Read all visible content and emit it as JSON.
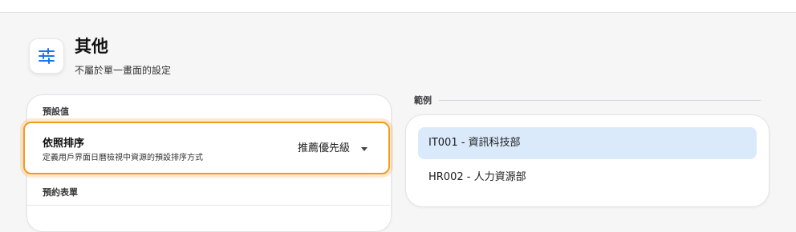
{
  "section": {
    "icon": "sliders-icon",
    "title": "其他",
    "subtitle": "不屬於單一畫面的設定"
  },
  "defaults": {
    "group_label": "預設值",
    "sort": {
      "title": "依照排序",
      "description": "定義用戶界面日曆檢視中資源的預設排序方式",
      "value": "推薦優先級"
    }
  },
  "booking_form": {
    "group_label": "預約表單"
  },
  "example": {
    "label": "範例",
    "items": [
      {
        "text": "IT001 - 資訊科技部",
        "highlighted": true
      },
      {
        "text": "HR002 - 人力資源部",
        "highlighted": false
      }
    ]
  },
  "colors": {
    "accent_orange": "#f49a1f",
    "icon_blue": "#1a73e8",
    "highlight_blue": "#dbeafb"
  }
}
